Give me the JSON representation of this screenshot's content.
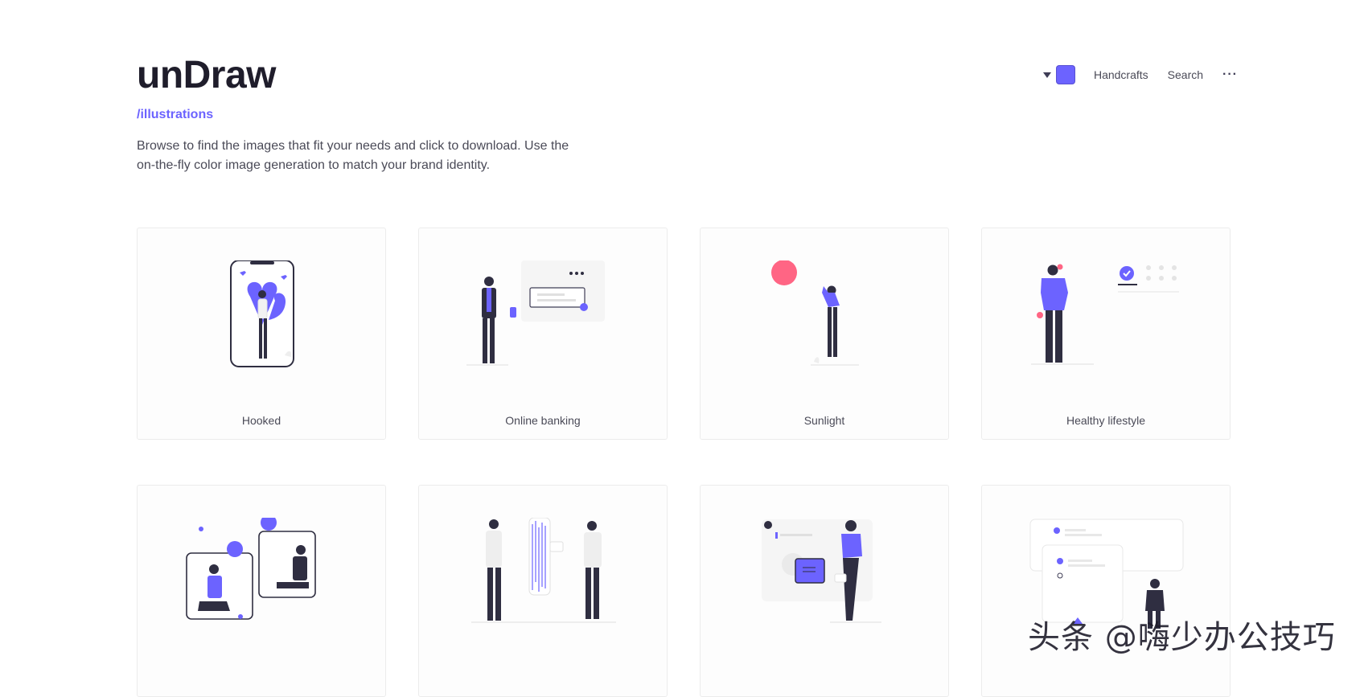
{
  "brand": {
    "name": "unDraw",
    "subtitle": "/illustrations"
  },
  "intro": {
    "description": "Browse to find the images that fit your needs and click to download. Use the on-the-fly color image generation to match your brand identity."
  },
  "nav": {
    "color_swatch": "#6c63ff",
    "links": [
      "Handcrafts",
      "Search"
    ],
    "more_label": "···"
  },
  "colors": {
    "accent": "#6c63ff",
    "dark": "#2f2e41",
    "pink": "#ff6584"
  },
  "cards": [
    {
      "title": "Hooked"
    },
    {
      "title": "Online banking"
    },
    {
      "title": "Sunlight"
    },
    {
      "title": "Healthy lifestyle"
    },
    {
      "title": ""
    },
    {
      "title": ""
    },
    {
      "title": ""
    },
    {
      "title": ""
    }
  ],
  "watermark": "头条 @嗨少办公技巧"
}
